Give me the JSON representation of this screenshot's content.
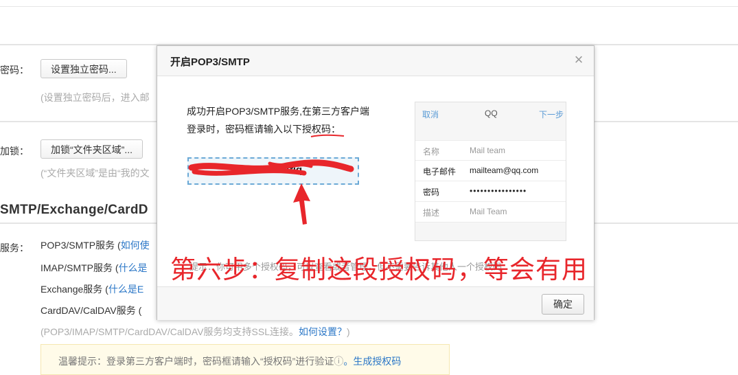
{
  "settings": {
    "password_label": "密码：",
    "set_password_button": "设置独立密码...",
    "password_hint": "(设置独立密码后，进入邮",
    "lock_label": "加锁：",
    "lock_button": "加锁“文件夹区域”...",
    "lock_hint": "(“文件夹区域”是由“我的文",
    "section_title": "SMTP/Exchange/CardD",
    "service_label": "服务：",
    "services": [
      {
        "name": "POP3/SMTP服务 (",
        "link": "如何使"
      },
      {
        "name": "IMAP/SMTP服务 (",
        "link": "什么是"
      },
      {
        "name": "Exchange服务 (",
        "link": "什么是E"
      },
      {
        "name": "CardDAV/CalDAV服务 (",
        "link": ""
      }
    ],
    "ssl_note": "(POP3/IMAP/SMTP/CardDAV/CalDAV服务均支持SSL连接。",
    "ssl_link": "如何设置？",
    "ssl_close": ")",
    "tip_text": "温馨提示：登录第三方客户端时，密码框请输入“授权码”进行验证",
    "tip_icon": "ⓘ",
    "tip_link": "。生成授权码"
  },
  "dialog": {
    "title": "开启POP3/SMTP",
    "close_label": "×",
    "message_line1": "成功开启POP3/SMTP服务,在第三方客户端",
    "message_line2_prefix": "登录时，密码框请输入以下",
    "message_line2_keyword": "授权码",
    "message_line2_suffix": "：",
    "auth_code_visible": "...kfiq",
    "note": "提示：你可用多个授权码，可以查看或者管理，但不需要告诉其他人一个授权码",
    "ok_button": "确定",
    "phone": {
      "cancel": "取消",
      "title": "QQ",
      "next": "下一步",
      "rows": [
        {
          "key": "名称",
          "value": "Mail team",
          "muted": true
        },
        {
          "key": "电子邮件",
          "value": "mailteam@qq.com",
          "muted": false
        },
        {
          "key": "密码",
          "value": "••••••••••••••••",
          "muted": false
        },
        {
          "key": "描述",
          "value": "Mail Team",
          "muted": true
        }
      ]
    }
  },
  "annotation": {
    "overlay_text": "第六步：复制这段授权码，等会有用",
    "color": "#e8262b"
  }
}
